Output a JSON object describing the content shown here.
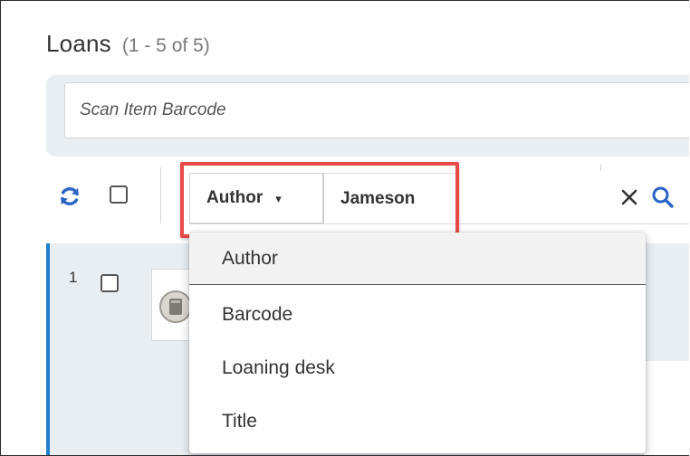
{
  "header": {
    "title": "Loans",
    "count": "(1 - 5 of 5)"
  },
  "scan": {
    "placeholder": "Scan Item Barcode"
  },
  "toolbar": {
    "icons": [
      "refresh-icon",
      "close-icon",
      "search-icon"
    ]
  },
  "search": {
    "field_label": "Author",
    "caret": "▾",
    "query": "Jameson"
  },
  "dropdown": {
    "options": [
      {
        "label": "Author",
        "selected": true
      },
      {
        "label": "Barcode",
        "selected": false
      },
      {
        "label": "Loaning desk",
        "selected": false
      },
      {
        "label": "Title",
        "selected": false
      }
    ]
  },
  "list": {
    "rows": [
      {
        "index": "1"
      }
    ]
  },
  "colors": {
    "accent": "#1f7ecc",
    "highlight": "#e84a4a",
    "panel": "#e9eef3"
  }
}
